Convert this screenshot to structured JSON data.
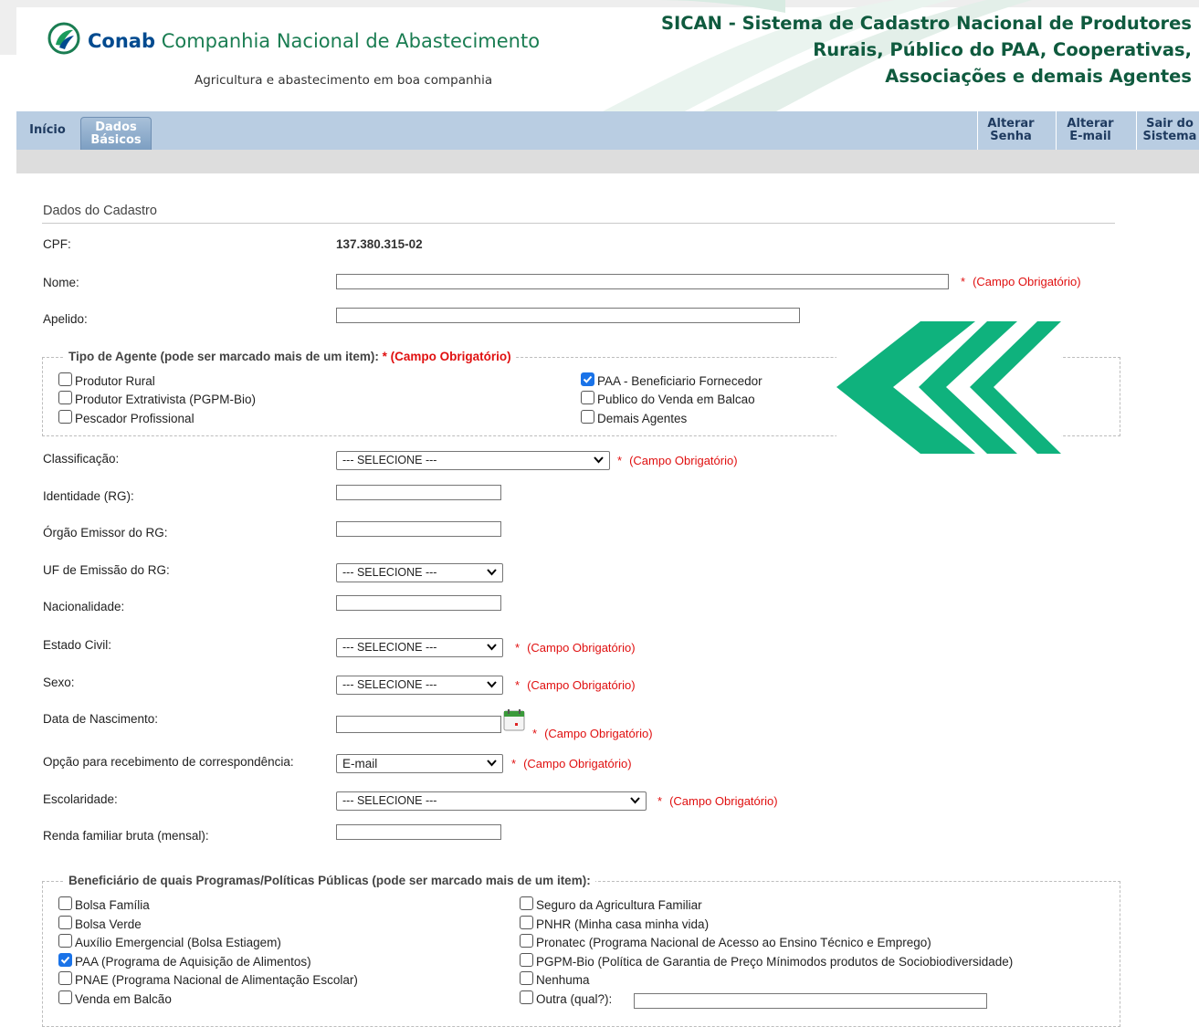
{
  "header": {
    "brand_bold": "Conab",
    "brand_rest": "Companhia Nacional de Abastecimento",
    "slogan": "Agricultura e abastecimento em boa companhia",
    "system_title_line1": "SICAN - Sistema de Cadastro Nacional de Produtores",
    "system_title_line2": "Rurais, Público do PAA, Cooperativas,",
    "system_title_line3": "Associações e demais Agentes"
  },
  "nav": {
    "inicio": "Início",
    "dados_l1": "Dados",
    "dados_l2": "Básicos",
    "senha_l1": "Alterar",
    "senha_l2": "Senha",
    "email_l1": "Alterar",
    "email_l2": "E-mail",
    "sair_l1": "Sair do",
    "sair_l2": "Sistema"
  },
  "form": {
    "section_title": "Dados do Cadastro",
    "cpf_label": "CPF:",
    "cpf_value": "137.380.315-02",
    "nome_label": "Nome:",
    "apelido_label": "Apelido:",
    "tipo_legend": "Tipo de Agente (pode ser marcado mais de um item):",
    "tipo_required": "* (Campo Obrigatório)",
    "tipo_options": [
      {
        "label": "Produtor Rural",
        "checked": false
      },
      {
        "label": "Produtor Extrativista (PGPM-Bio)",
        "checked": false
      },
      {
        "label": "Pescador Profissional",
        "checked": false
      },
      {
        "label": "PAA - Beneficiario Fornecedor",
        "checked": true
      },
      {
        "label": "Publico do Venda em Balcao",
        "checked": false
      },
      {
        "label": "Demais Agentes",
        "checked": false
      }
    ],
    "classificacao_label": "Classificação:",
    "identidade_label": "Identidade (RG):",
    "orgao_label": "Órgão Emissor do RG:",
    "uf_label": "UF de Emissão do RG:",
    "nacionalidade_label": "Nacionalidade:",
    "estado_civil_label": "Estado Civil:",
    "sexo_label": "Sexo:",
    "nascimento_label": "Data de Nascimento:",
    "correspondencia_label": "Opção para recebimento de correspondência:",
    "correspondencia_value": "E-mail",
    "escolaridade_label": "Escolaridade:",
    "renda_label": "Renda familiar bruta (mensal):",
    "select_placeholder": "--- SELECIONE ---",
    "required_star": "*",
    "required_text": "(Campo Obrigatório)",
    "programas_legend": "Beneficiário de quais Programas/Políticas Públicas (pode ser marcado mais de um item):",
    "programas_left": [
      {
        "label": "Bolsa Família",
        "checked": false
      },
      {
        "label": "Bolsa Verde",
        "checked": false
      },
      {
        "label": "Auxílio Emergencial (Bolsa Estiagem)",
        "checked": false
      },
      {
        "label": "PAA (Programa de Aquisição de Alimentos)",
        "checked": true
      },
      {
        "label": "PNAE (Programa Nacional de Alimentação Escolar)",
        "checked": false
      },
      {
        "label": "Venda em Balcão",
        "checked": false
      }
    ],
    "programas_right": [
      {
        "label": "Seguro da Agricultura Familiar",
        "checked": false
      },
      {
        "label": "PNHR (Minha casa minha vida)",
        "checked": false
      },
      {
        "label": "Pronatec (Programa Nacional de Acesso ao Ensino Técnico e Emprego)",
        "checked": false
      },
      {
        "label": "PGPM-Bio (Política de Garantia de Preço Mínimodos produtos de Sociobiodiversidade)",
        "checked": false
      },
      {
        "label": "Nenhuma",
        "checked": false
      },
      {
        "label": "Outra (qual?):",
        "checked": false
      }
    ]
  },
  "colors": {
    "accent_green": "#00a86b",
    "nav_blue": "#b9cde2",
    "required_red": "#e01010",
    "checkbox_blue": "#1a73e8"
  }
}
